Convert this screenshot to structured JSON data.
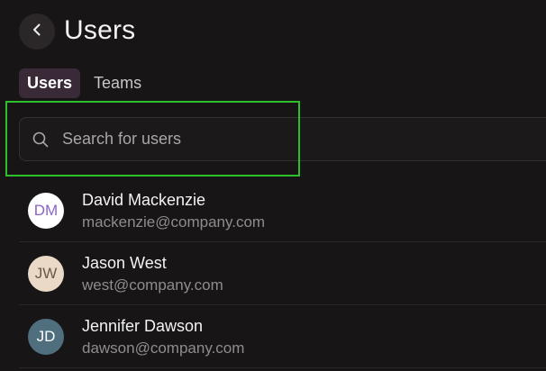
{
  "header": {
    "title": "Users"
  },
  "tabs": [
    {
      "label": "Users",
      "active": true
    },
    {
      "label": "Teams",
      "active": false
    }
  ],
  "search": {
    "placeholder": "Search for users",
    "value": ""
  },
  "users": [
    {
      "initials": "DM",
      "name": "David Mackenzie",
      "email": "mackenzie@company.com",
      "avatar_bg": "#ffffff",
      "avatar_fg": "#8a63c9"
    },
    {
      "initials": "JW",
      "name": "Jason West",
      "email": "west@company.com",
      "avatar_bg": "#e9d9c6",
      "avatar_fg": "#6b5a48"
    },
    {
      "initials": "JD",
      "name": "Jennifer Dawson",
      "email": "dawson@company.com",
      "avatar_bg": "#4f6f7f",
      "avatar_fg": "#ffffff"
    }
  ],
  "colors": {
    "accent_tab_bg": "#3a2a37",
    "highlight": "#2ec02b",
    "background": "#181516"
  },
  "icons": {
    "back": "chevron-left-icon",
    "search": "search-icon"
  }
}
